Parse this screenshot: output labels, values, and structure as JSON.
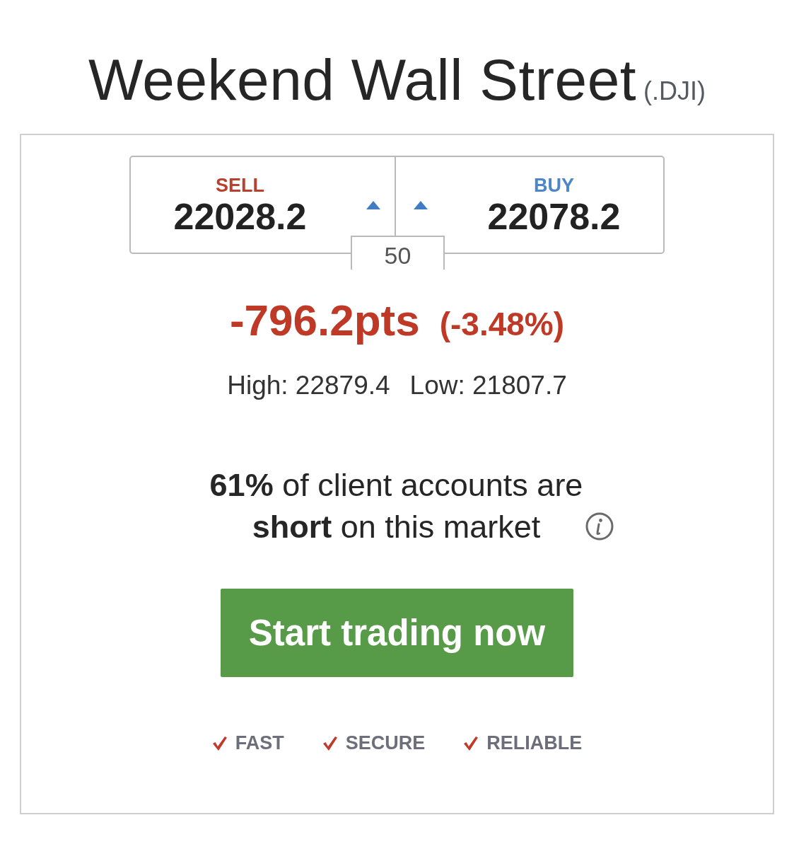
{
  "title": "Weekend Wall Street",
  "symbol": "(.DJI)",
  "quotes": [
    {
      "kind": "sell",
      "label": "SELL",
      "price": "22028.2",
      "up": true
    },
    {
      "kind": "buy",
      "label": "BUY",
      "price": "22078.2",
      "up": true
    }
  ],
  "spread": "50",
  "change": {
    "negative": true,
    "points": "-796.2pts",
    "percent": "(-3.48%)"
  },
  "range": [
    "High: 22879.4",
    "Low: 21807.7"
  ],
  "sentiment": "**61%** of client accounts are **short** on this market",
  "cta": "Start trading now",
  "features": [
    "FAST",
    "SECURE",
    "RELIABLE"
  ]
}
